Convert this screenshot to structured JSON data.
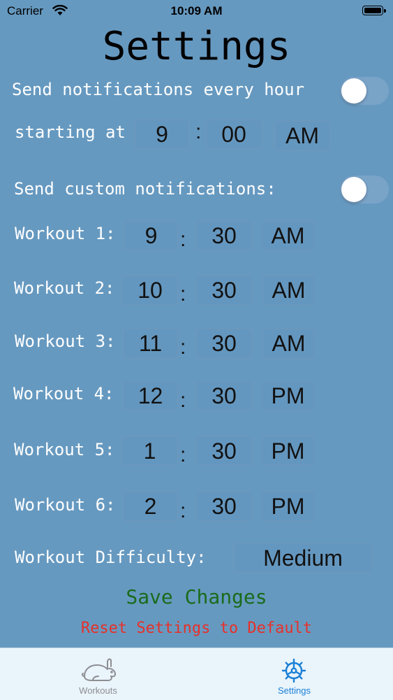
{
  "status_bar": {
    "carrier": "Carrier",
    "time": "10:09 AM"
  },
  "title": "Settings",
  "hourly": {
    "label": "Send notifications every hour",
    "toggle_on": false,
    "starting_label": "starting at",
    "hour": "9",
    "colon": ":",
    "minute": "00",
    "period": "AM"
  },
  "custom": {
    "label": "Send custom notifications:",
    "toggle_on": false
  },
  "workouts": [
    {
      "label": "Workout 1:",
      "hour": "9",
      "colon": ":",
      "minute": "30",
      "period": "AM"
    },
    {
      "label": "Workout 2:",
      "hour": "10",
      "colon": ":",
      "minute": "30",
      "period": "AM"
    },
    {
      "label": "Workout 3:",
      "hour": "11",
      "colon": ":",
      "minute": "30",
      "period": "AM"
    },
    {
      "label": "Workout 4:",
      "hour": "12",
      "colon": ":",
      "minute": "30",
      "period": "PM"
    },
    {
      "label": "Workout 5:",
      "hour": "1",
      "colon": ":",
      "minute": "30",
      "period": "PM"
    },
    {
      "label": "Workout 6:",
      "hour": "2",
      "colon": ":",
      "minute": "30",
      "period": "PM"
    }
  ],
  "difficulty": {
    "label": "Workout Difficulty:",
    "value": "Medium"
  },
  "actions": {
    "save": "Save Changes",
    "reset": "Reset Settings to Default"
  },
  "tabs": [
    {
      "label": "Workouts",
      "icon": "rabbit-icon",
      "active": false
    },
    {
      "label": "Settings",
      "icon": "gear-icon",
      "active": true
    }
  ],
  "colors": {
    "background": "#6699c0",
    "save": "#1a6b1a",
    "reset": "#e6312a",
    "tab_active": "#1a7fd6",
    "tab_inactive": "#8e8e93"
  }
}
